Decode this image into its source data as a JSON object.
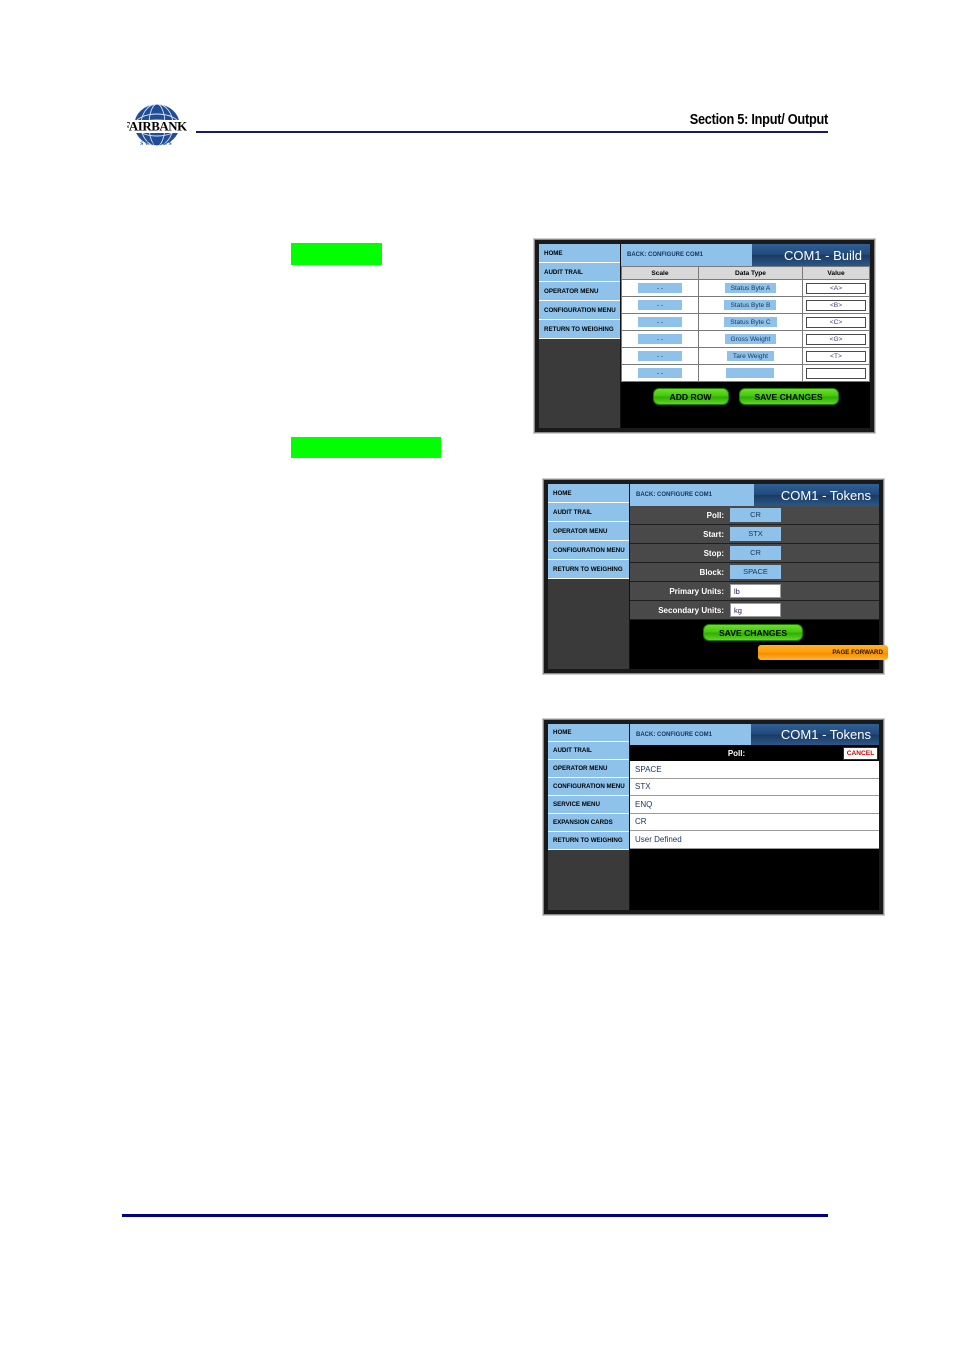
{
  "header": {
    "section_title": "Section 5: Input/ Output",
    "logo_brand": "FAIRBANKS",
    "logo_sub": "S C A L E S",
    "logo_icon": "globe-icon"
  },
  "callouts": [
    {
      "id": "green-1",
      "text": ""
    },
    {
      "id": "green-2",
      "text": ""
    }
  ],
  "panel_build": {
    "sidebar": [
      "HOME",
      "AUDIT TRAIL",
      "OPERATOR MENU",
      "CONFIGURATION MENU",
      "RETURN TO WEIGHING"
    ],
    "back_label": "BACK: CONFIGURE COM1",
    "title": "COM1 - Build",
    "columns": [
      "Scale",
      "Data Type",
      "Value"
    ],
    "rows": [
      {
        "scale": "- -",
        "data_type": "Status Byte A",
        "value": "<A>"
      },
      {
        "scale": "- -",
        "data_type": "Status Byte B",
        "value": "<B>"
      },
      {
        "scale": "- -",
        "data_type": "Status Byte C",
        "value": "<C>"
      },
      {
        "scale": "- -",
        "data_type": "Gross Weight",
        "value": "<G>"
      },
      {
        "scale": "- -",
        "data_type": "Tare Weight",
        "value": "<T>"
      },
      {
        "scale": "- -",
        "data_type": "",
        "value": ""
      }
    ],
    "add_row_label": "ADD ROW",
    "save_changes_label": "SAVE CHANGES"
  },
  "panel_tokens": {
    "sidebar": [
      "HOME",
      "AUDIT TRAIL",
      "OPERATOR MENU",
      "CONFIGURATION MENU",
      "RETURN TO WEIGHING"
    ],
    "back_label": "BACK: CONFIGURE COM1",
    "title": "COM1 - Tokens",
    "fields": [
      {
        "label": "Poll:",
        "value": "CR",
        "kind": "button"
      },
      {
        "label": "Start:",
        "value": "STX",
        "kind": "button"
      },
      {
        "label": "Stop:",
        "value": "CR",
        "kind": "button"
      },
      {
        "label": "Block:",
        "value": "SPACE",
        "kind": "button"
      },
      {
        "label": "Primary Units:",
        "value": "lb",
        "kind": "input"
      },
      {
        "label": "Secondary Units:",
        "value": "kg",
        "kind": "input"
      }
    ],
    "save_changes_label": "SAVE CHANGES",
    "page_forward_label": "PAGE FORWARD"
  },
  "panel_token_list": {
    "sidebar": [
      "HOME",
      "AUDIT TRAIL",
      "OPERATOR MENU",
      "CONFIGURATION MENU",
      "SERVICE MENU",
      "EXPANSION CARDS",
      "RETURN TO WEIGHING"
    ],
    "back_label": "BACK: CONFIGURE COM1",
    "title": "COM1 - Tokens",
    "prompt": "Poll:",
    "cancel_label": "CANCEL",
    "options": [
      "SPACE",
      "STX",
      "ENQ",
      "CR",
      "User Defined"
    ]
  },
  "colors": {
    "rule_navy": "#191970",
    "footer_navy": "#00008b",
    "highlight_green": "#00ff00",
    "ui_blue": "#8ec2ea",
    "title_blue": "#23497a",
    "button_green": "#47c510",
    "button_orange": "#ff9b08",
    "cancel_red": "#d40000",
    "sidebar_dark": "#3a3a3a"
  }
}
